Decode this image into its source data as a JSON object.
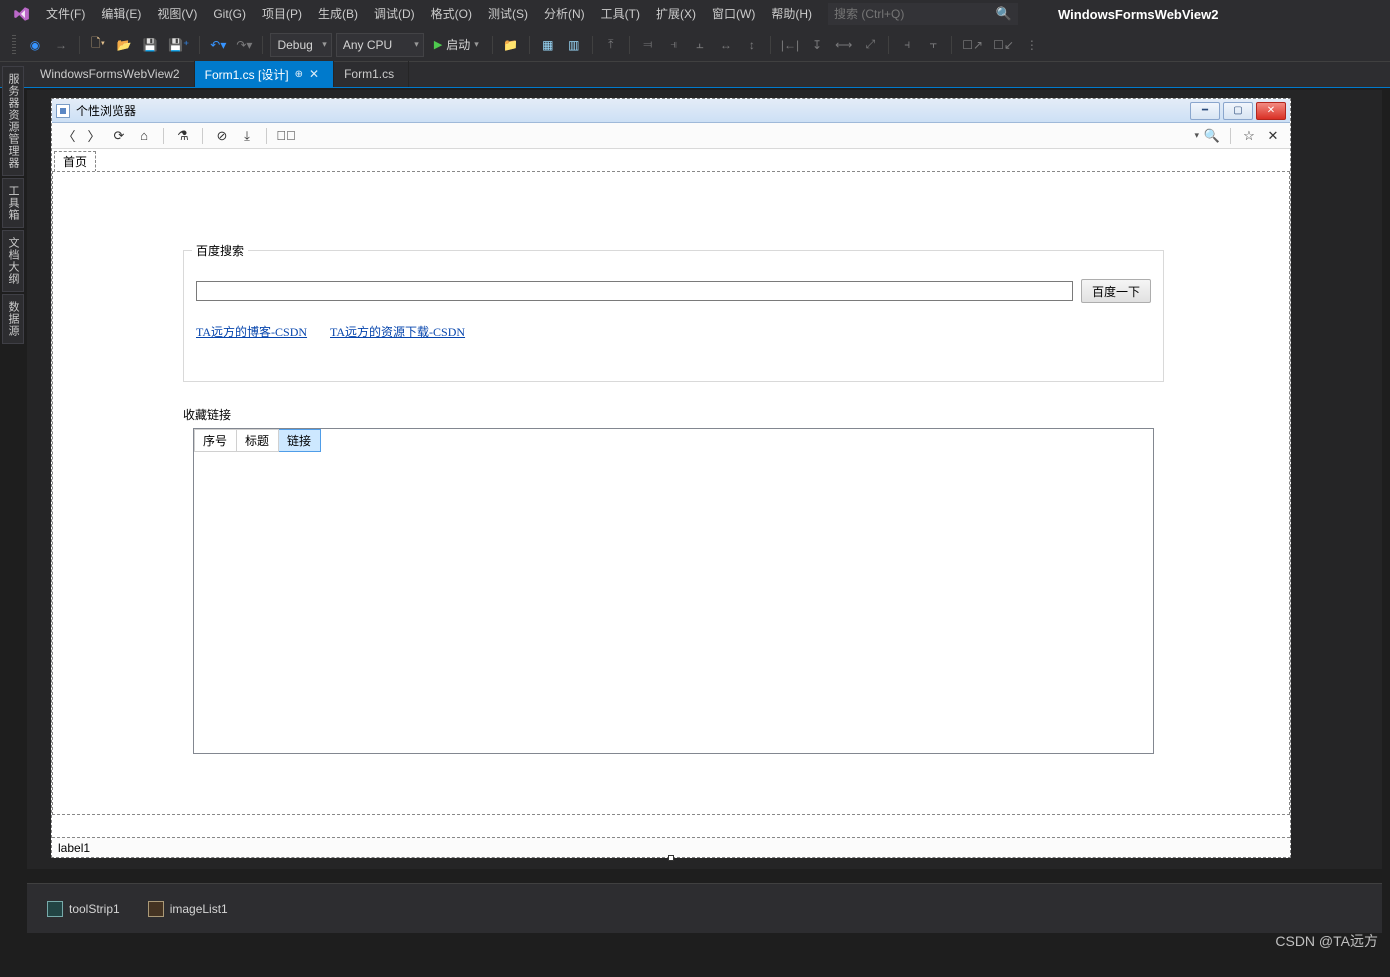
{
  "menubar": {
    "items": [
      "文件(F)",
      "编辑(E)",
      "视图(V)",
      "Git(G)",
      "项目(P)",
      "生成(B)",
      "调试(D)",
      "格式(O)",
      "测试(S)",
      "分析(N)",
      "工具(T)",
      "扩展(X)",
      "窗口(W)",
      "帮助(H)"
    ],
    "search_placeholder": "搜索 (Ctrl+Q)",
    "app_title": "WindowsFormsWebView2"
  },
  "toolbar": {
    "config": "Debug",
    "platform": "Any CPU",
    "start_label": "启动"
  },
  "left_tool_tabs": [
    "服务器资源管理器",
    "工具箱",
    "文档大纲",
    "数据源"
  ],
  "doc_tabs": [
    {
      "label": "WindowsFormsWebView2",
      "active": false
    },
    {
      "label": "Form1.cs [设计]",
      "active": true
    },
    {
      "label": "Form1.cs",
      "active": false
    }
  ],
  "winform": {
    "title": "个性浏览器",
    "tab_label": "首页",
    "search_group_title": "百度搜索",
    "search_button": "百度一下",
    "link_a": "TA远方的博客-CSDN",
    "link_b": "TA远方的资源下载-CSDN",
    "fav_label": "收藏链接",
    "grid_cols": [
      "序号",
      "标题",
      "链接"
    ],
    "status_label": "label1"
  },
  "tray": {
    "item1": "toolStrip1",
    "item2": "imageList1"
  },
  "watermark": "CSDN @TA远方"
}
